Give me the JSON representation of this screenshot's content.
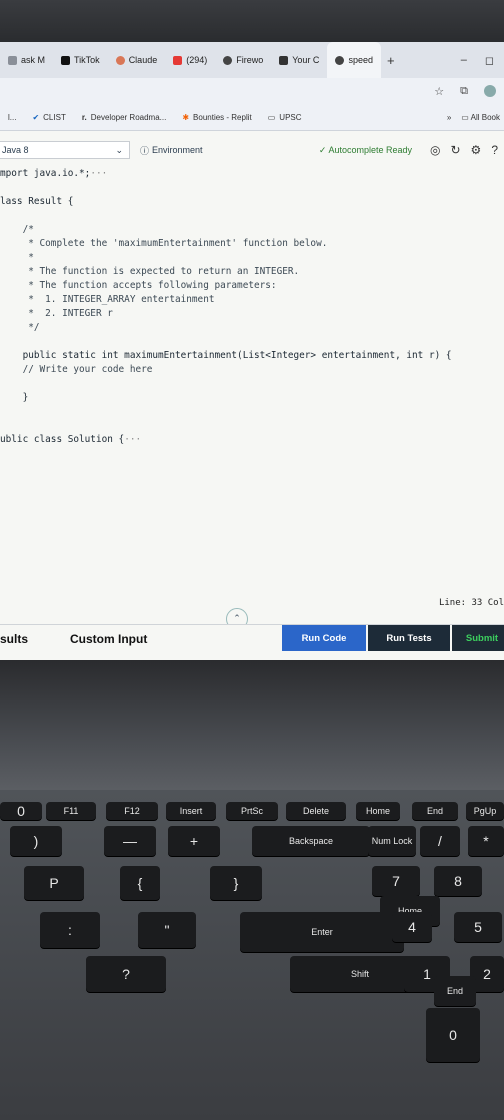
{
  "browser": {
    "tabs": [
      {
        "label": "ask M",
        "color": "#8a8f98"
      },
      {
        "label": "TikTok",
        "color": "#111111"
      },
      {
        "label": "Claude",
        "color": "#d97757"
      },
      {
        "label": "(294)",
        "color": "#e53935"
      },
      {
        "label": "Firewo",
        "color": "#444444"
      },
      {
        "label": "Your C",
        "color": "#333333"
      },
      {
        "label": "speed",
        "color": "#444444"
      }
    ],
    "new_tab": "+",
    "bookmarks": [
      {
        "label": "l..."
      },
      {
        "label": "CLIST"
      },
      {
        "label": "Developer Roadma..."
      },
      {
        "label": "Bounties - Replit"
      },
      {
        "label": "UPSC"
      }
    ],
    "bookmarks_more": "»",
    "all_bookmarks": "All Book"
  },
  "editor": {
    "language": "Java 8",
    "environment": "Environment",
    "autocomplete": "Autocomplete Ready",
    "code_lines": [
      {
        "text": "mport java.io.*;",
        "suffix": "···",
        "style": "plain"
      },
      {
        "text": "",
        "style": "plain"
      },
      {
        "text": "lass Result {",
        "style": "plain"
      },
      {
        "text": "",
        "style": "plain"
      },
      {
        "text": "    /*",
        "style": "comment"
      },
      {
        "text": "     * Complete the 'maximumEntertainment' function below.",
        "style": "comment"
      },
      {
        "text": "     *",
        "style": "comment"
      },
      {
        "text": "     * The function is expected to return an INTEGER.",
        "style": "comment"
      },
      {
        "text": "     * The function accepts following parameters:",
        "style": "comment"
      },
      {
        "text": "     *  1. INTEGER_ARRAY entertainment",
        "style": "comment"
      },
      {
        "text": "     *  2. INTEGER r",
        "style": "comment"
      },
      {
        "text": "     */",
        "style": "comment"
      },
      {
        "text": "",
        "style": "plain"
      },
      {
        "text": "    public static int maximumEntertainment(List<Integer> entertainment, int r) {",
        "style": "plain"
      },
      {
        "text": "    // Write your code here",
        "style": "comment"
      },
      {
        "text": "",
        "style": "plain"
      },
      {
        "text": "    }",
        "style": "plain"
      },
      {
        "text": "",
        "style": "plain"
      },
      {
        "text": "",
        "style": "plain"
      },
      {
        "text": "ublic class Solution {",
        "suffix": "···",
        "style": "plain"
      }
    ],
    "status": "Line: 33 Col"
  },
  "panel": {
    "results_tab": "sults",
    "custom_input_tab": "Custom Input",
    "run_code": "Run Code",
    "run_tests": "Run Tests",
    "submit": "Submit"
  },
  "keyboard": {
    "keys": [
      "0",
      "F11",
      "F12",
      "Insert",
      "PrtSc",
      "Delete",
      "Home",
      "End",
      "PgUp",
      ")",
      "—",
      "+",
      "Backspace",
      "Num Lock",
      "/",
      "*",
      "P",
      "{",
      "}",
      "7",
      "8",
      "Home",
      ":",
      "\"",
      "Enter",
      "4",
      "5",
      "?",
      "Shift",
      "1",
      "2",
      "End",
      "0"
    ]
  }
}
